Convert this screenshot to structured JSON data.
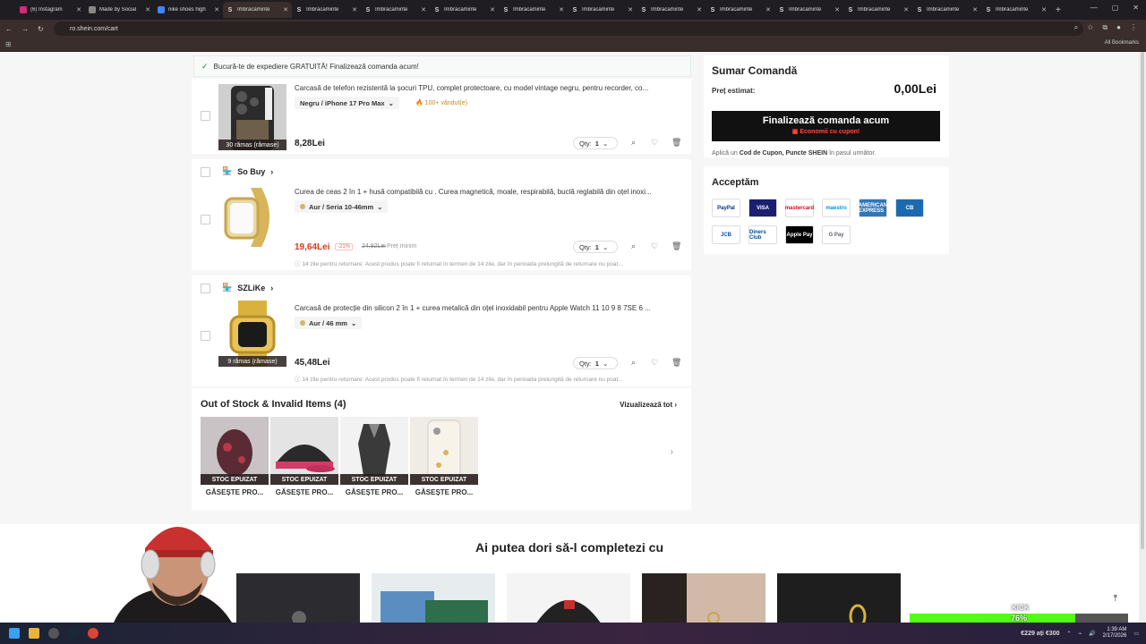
{
  "browser": {
    "tabs": [
      {
        "label": "(6) Instagram",
        "active": false
      },
      {
        "label": "Made by Social",
        "active": false
      },
      {
        "label": "nike shoes high",
        "active": false
      },
      {
        "label": "Îmbrăcăminte",
        "active": true
      },
      {
        "label": "Îmbrăcăminte",
        "active": false
      },
      {
        "label": "Îmbrăcăminte",
        "active": false
      },
      {
        "label": "Îmbrăcăminte",
        "active": false
      },
      {
        "label": "Îmbrăcăminte",
        "active": false
      },
      {
        "label": "Îmbrăcăminte",
        "active": false
      },
      {
        "label": "Îmbrăcăminte",
        "active": false
      },
      {
        "label": "Îmbrăcăminte",
        "active": false
      },
      {
        "label": "Îmbrăcăminte",
        "active": false
      },
      {
        "label": "Îmbrăcăminte",
        "active": false
      },
      {
        "label": "Îmbrăcăminte",
        "active": false
      },
      {
        "label": "Îmbrăcăminte",
        "active": false
      }
    ],
    "url": "ro.shein.com/cart",
    "all_bookmarks": "All Bookmarks"
  },
  "shipping_banner": "Bucură-te de expediere GRATUITĂ! Finalizează comanda acum!",
  "items": [
    {
      "title": "Carcasă de telefon rezistentă la șocuri TPU, complet protectoare, cu model vintage negru, pentru recorder, co...",
      "variant": "Negru / iPhone 17 Pro Max",
      "sold": "100+ vândut(e)",
      "badge": "30 rămas (rămase)",
      "price": "8,28Lei",
      "qty_label": "Qty:",
      "qty": "1"
    },
    {
      "store": "So Buy",
      "title": "Curea de ceas 2 în 1 + husă compatibilă cu . Curea magnetică, moale, respirabilă, buclă reglabilă din oțel inoxi...",
      "variant": "Aur / Seria 10-46mm",
      "price": "19,64Lei",
      "discount": "-21%",
      "original": "24,92Lei",
      "min_price": "Preț minim",
      "qty_label": "Qty:",
      "qty": "1",
      "returns": "14 zile pentru returnare: Acest produs poate fi returnat în termen de 14 zile, dar în perioada prelungită de returnare nu poat..."
    },
    {
      "store": "SZLiKe",
      "title": "Carcasă de protecție din silicon 2 în 1 + curea metalică din oțel inoxidabil pentru Apple Watch 11 10 9 8 7SE 6 ...",
      "variant": "Aur / 46 mm",
      "badge": "9 rămas (rămase)",
      "price": "45,48Lei",
      "qty_label": "Qty:",
      "qty": "1",
      "returns": "14 zile pentru returnare: Acest produs poate fi returnat în termen de 14 zile, dar în perioada prelungită de returnare nu poat..."
    }
  ],
  "out_of_stock": {
    "title": "Out of Stock & Invalid Items (4)",
    "view_all": "Vizualizează tot",
    "badge": "STOC EPUIZAT",
    "caption": "GĂSEȘTE PRO..."
  },
  "summary": {
    "title": "Sumar Comandă",
    "estimate_label": "Preț estimat:",
    "estimate_value": "0,00Lei",
    "checkout_label": "Finalizează comanda acum",
    "checkout_sub": "Economii cu cupon!",
    "note_pre": "Aplică un",
    "note_bold": "Cod de Cupon, Puncte SHEIN",
    "note_post": "în pasul următor."
  },
  "accept": {
    "title": "Acceptăm",
    "methods": [
      {
        "name": "PayPal",
        "bg": "#ffffff",
        "fg": "#003087"
      },
      {
        "name": "VISA",
        "bg": "#1a1f71",
        "fg": "#ffffff"
      },
      {
        "name": "mastercard",
        "bg": "#ffffff",
        "fg": "#eb001b"
      },
      {
        "name": "maestro",
        "bg": "#ffffff",
        "fg": "#0099df"
      },
      {
        "name": "AMERICAN EXPRESS",
        "bg": "#2e77bb",
        "fg": "#ffffff"
      },
      {
        "name": "CB",
        "bg": "#1b6ab1",
        "fg": "#ffffff"
      },
      {
        "name": "JCB",
        "bg": "#ffffff",
        "fg": "#0b4ea2"
      },
      {
        "name": "Diners Club",
        "bg": "#ffffff",
        "fg": "#004a97"
      },
      {
        "name": "Apple Pay",
        "bg": "#000000",
        "fg": "#ffffff"
      },
      {
        "name": "G Pay",
        "bg": "#ffffff",
        "fg": "#5f6368"
      }
    ]
  },
  "recommend": {
    "title": "Ai putea dori să-l completezi cu"
  },
  "overlay": {
    "kick": "KICK",
    "percent": "76%",
    "percent_value": 0.76,
    "sub": "€229 ați €300"
  },
  "taskbar": {
    "time": "1:39 AM",
    "date": "2/17/2026"
  },
  "colors": {
    "accent": "#d9381e",
    "checkout_bg": "#111111",
    "kick_green": "#53fc18"
  }
}
